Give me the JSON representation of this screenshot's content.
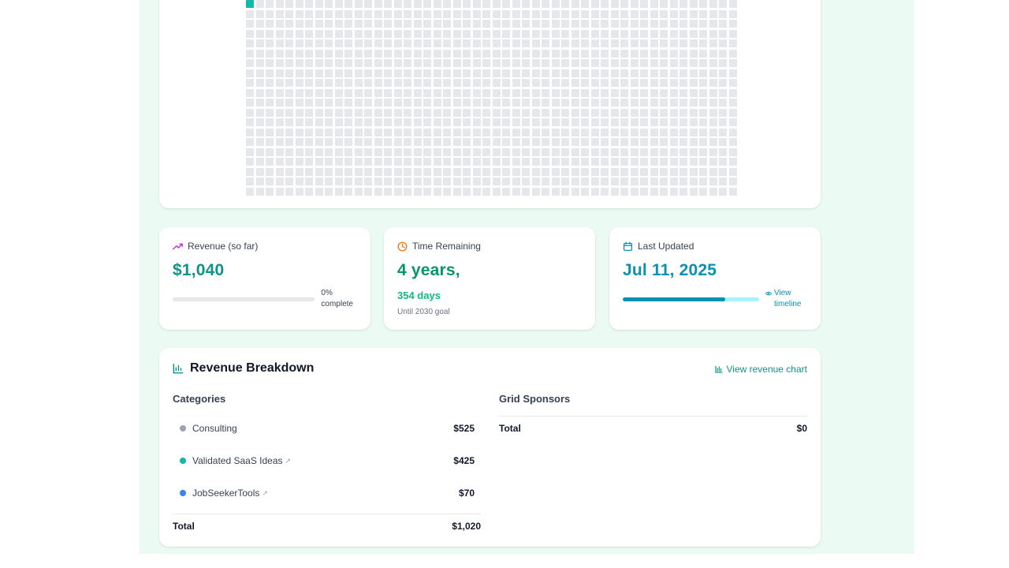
{
  "grid": {
    "total_cells": 1000,
    "filled_cells": 1,
    "fill_color": "#14b8a6",
    "empty_color": "#e5e7eb"
  },
  "stats": {
    "revenue": {
      "label": "Revenue (so far)",
      "value": "$1,040",
      "progress_label": "0% complete",
      "progress": 0.0,
      "icon": "trending-up-icon",
      "color": "#0d9488"
    },
    "time": {
      "label": "Time Remaining",
      "years": "4 years,",
      "days": "354 days",
      "note": "Until 2030 goal",
      "icon": "clock-icon",
      "color": "#059669"
    },
    "updated": {
      "label": "Last Updated",
      "value": "Jul 11, 2025",
      "link": "View timeline",
      "progress": 0.75,
      "icon": "calendar-icon",
      "color": "#0891b2"
    }
  },
  "breakdown": {
    "title": "Revenue Breakdown",
    "chart_link": "View revenue chart",
    "categories_title": "Categories",
    "sponsors_title": "Grid Sponsors",
    "categories": [
      {
        "name": "Consulting",
        "amount": "$525",
        "color": "#9ca3af",
        "external": false
      },
      {
        "name": "Validated SaaS Ideas",
        "amount": "$425",
        "color": "#14b8a6",
        "external": true
      },
      {
        "name": "JobSeekerTools",
        "amount": "$70",
        "color": "#3b82f6",
        "external": true
      }
    ],
    "categories_total_label": "Total",
    "categories_total": "$1,020",
    "sponsors_total_label": "Total",
    "sponsors_total": "$0"
  }
}
